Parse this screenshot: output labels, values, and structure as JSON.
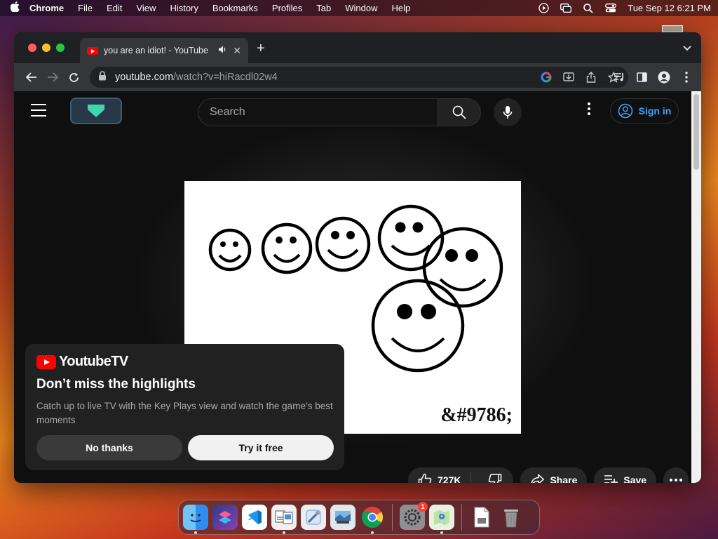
{
  "menubar": {
    "app_name": "Chrome",
    "menus": [
      "File",
      "Edit",
      "View",
      "History",
      "Bookmarks",
      "Profiles",
      "Tab",
      "Window",
      "Help"
    ],
    "clock": "Tue Sep 12  6:21 PM"
  },
  "browser": {
    "tab": {
      "title": "you are an idiot! - YouTube",
      "close": "✕"
    },
    "new_tab": "+",
    "url_host": "youtube.com",
    "url_path": "/watch?v=hiRacdl02w4"
  },
  "youtube": {
    "search_placeholder": "Search",
    "sign_in": "Sign in",
    "video_watermark": "&#9786;",
    "likes": "727K",
    "share": "Share",
    "save": "Save",
    "more": "•••"
  },
  "promo": {
    "brand": "YoutubeTV",
    "title": "Don’t miss the highlights",
    "body": "Catch up to live TV with the Key Plays view and watch the game’s best moments",
    "decline": "No thanks",
    "accept": "Try it free"
  },
  "dock": {
    "apps": [
      "finder-icon",
      "shortcuts-icon",
      "vscode-icon",
      "preview-icon",
      "xcode-icon",
      "image-capture-icon",
      "chrome-icon",
      "system-settings-icon",
      "maps-icon",
      "text-document-icon",
      "trash-icon"
    ],
    "settings_badge": "1"
  },
  "colors": {
    "youtube_red": "#ff0000",
    "link_blue": "#3ea6ff",
    "page_bg": "#0f0f0f"
  }
}
